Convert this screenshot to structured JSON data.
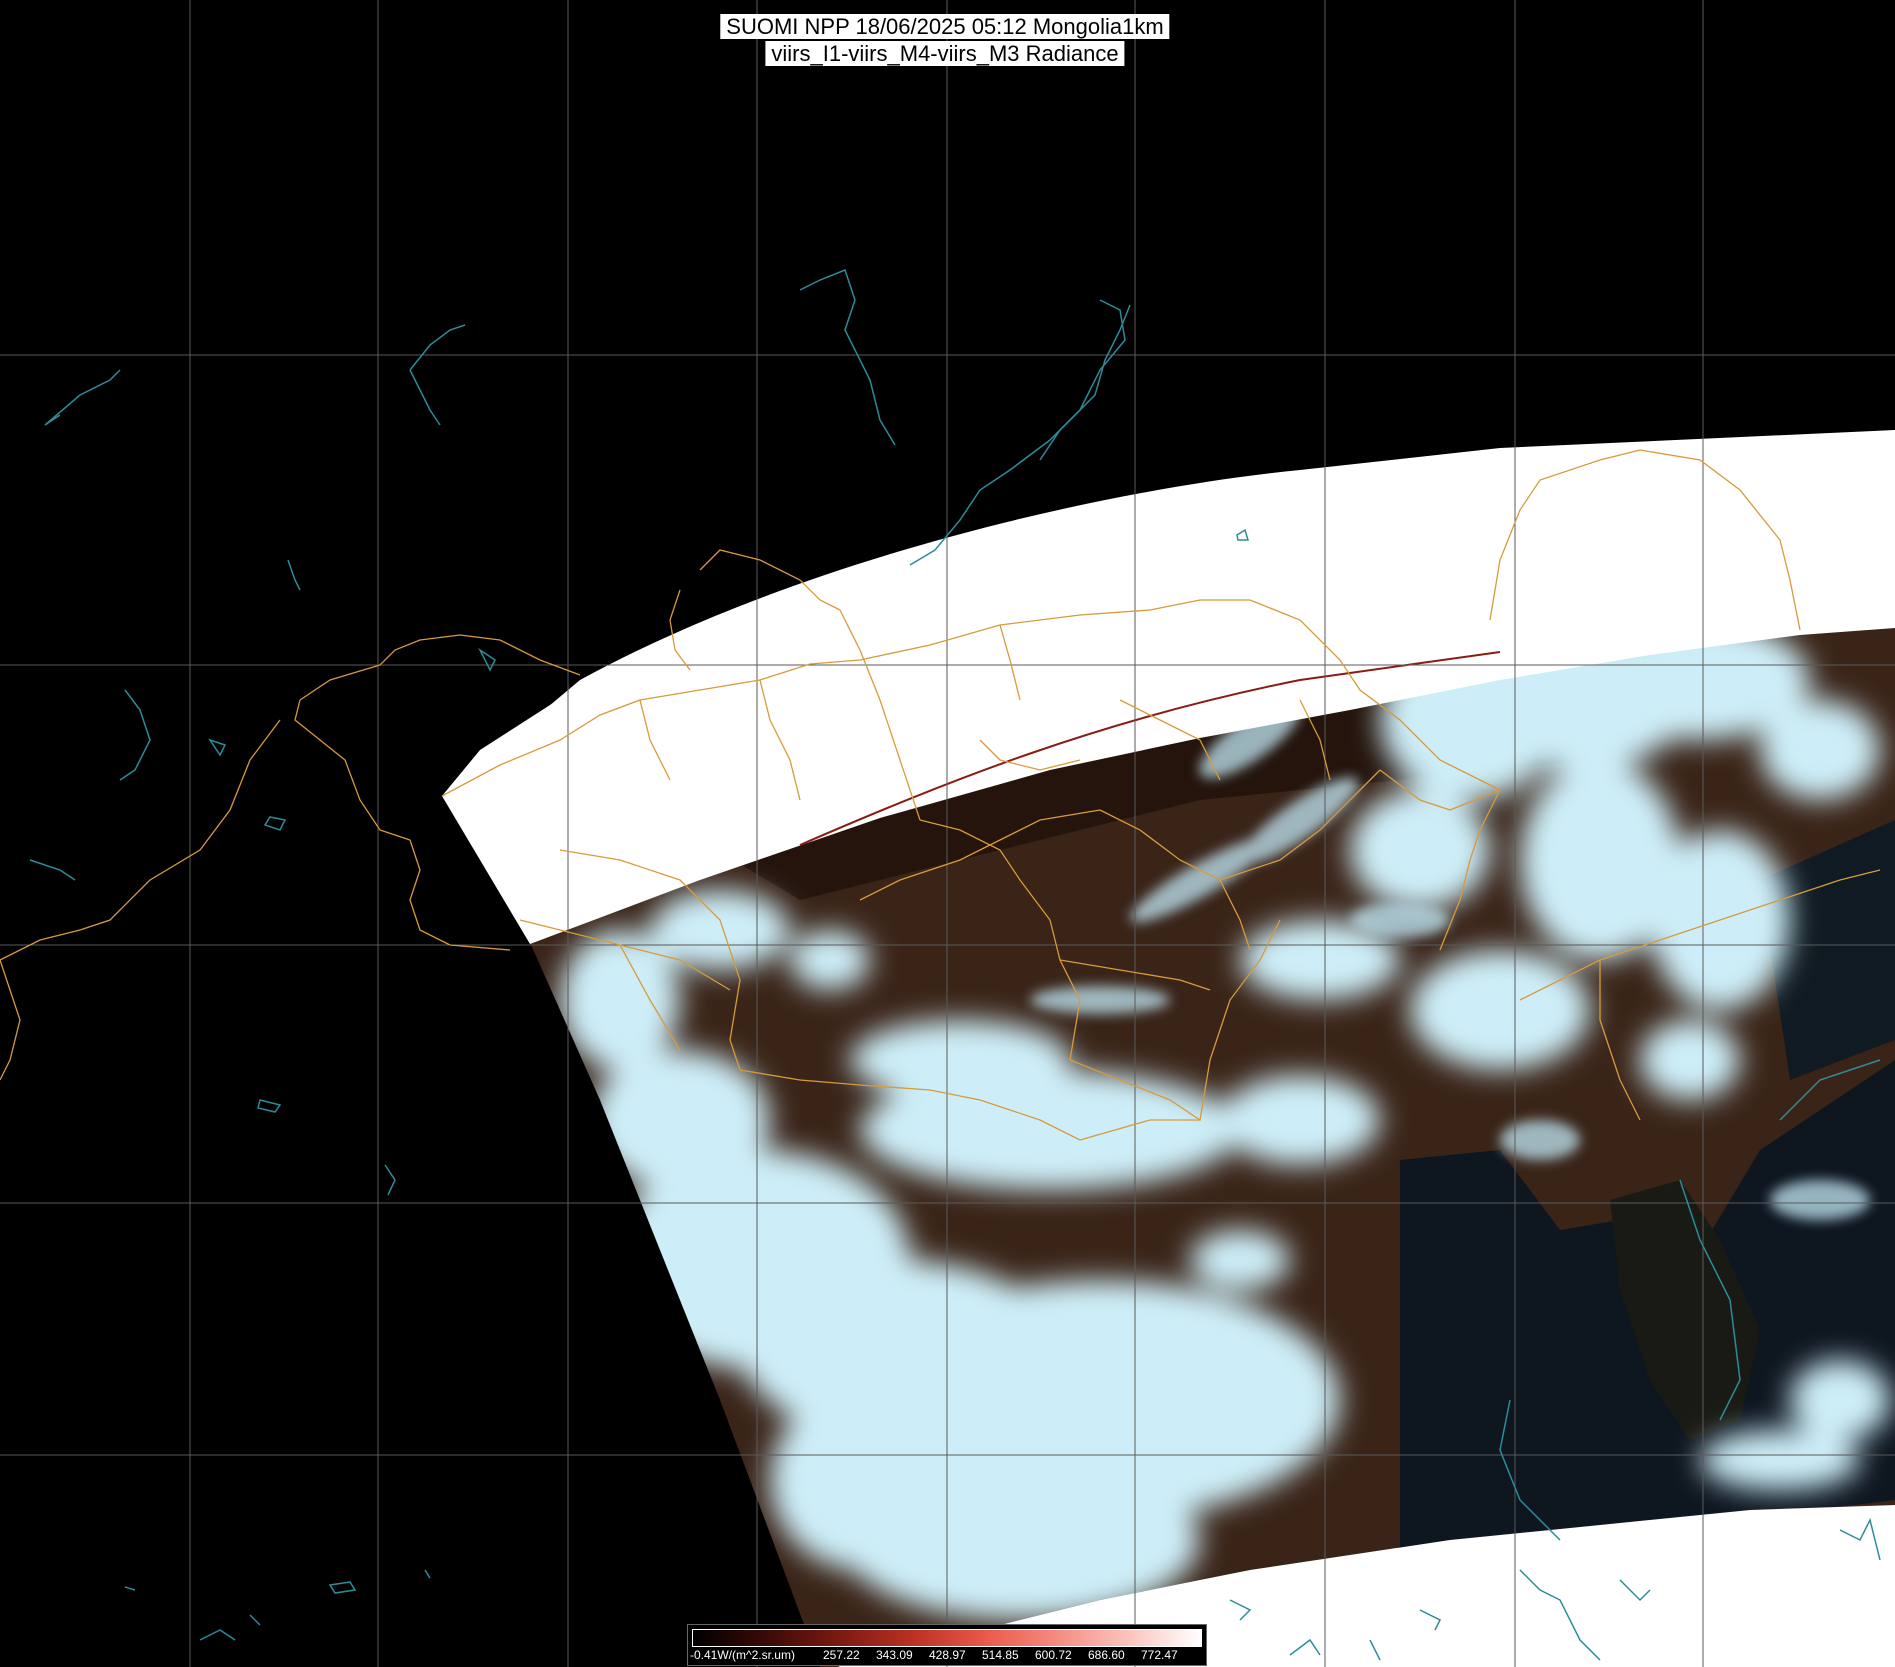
{
  "title": {
    "line1": "SUOMI NPP 18/06/2025 05:12 Mongolia1km",
    "line2": "viirs_I1-viirs_M4-viirs_M3 Radiance"
  },
  "colorbar": {
    "labels": [
      "-0.41W/(m^2.sr.um)",
      "257.22",
      "343.09",
      "428.97",
      "514.85",
      "600.72",
      "686.60",
      "772.47"
    ],
    "colors": [
      "#000000",
      "#3a0a06",
      "#7a1a10",
      "#b83024",
      "#e8584a",
      "#f48c80",
      "#fbc4bd",
      "#ffffff"
    ]
  },
  "colors": {
    "background": "#000000",
    "gridline": "#5a5a5a",
    "coastline": "#2d8c9a",
    "admin_border": "#d89a3a",
    "saturated_swath": "#ffffff",
    "cloud": "#cdeef8",
    "land": "#3a2418",
    "sea": "#0e1620"
  }
}
